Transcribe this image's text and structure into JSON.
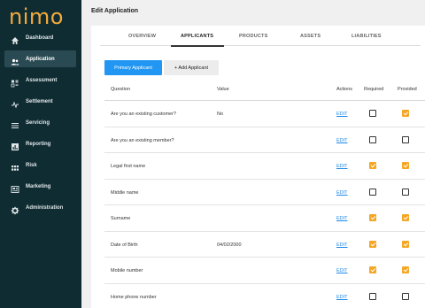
{
  "brand": {
    "logo_text": "nimo"
  },
  "sidebar": {
    "items": [
      {
        "label": "Dashboard",
        "icon": "home-icon"
      },
      {
        "label": "Application",
        "icon": "people-icon",
        "active": true
      },
      {
        "label": "Assessment",
        "icon": "assessment-icon"
      },
      {
        "label": "Settlement",
        "icon": "settlement-icon"
      },
      {
        "label": "Servicing",
        "icon": "list-icon"
      },
      {
        "label": "Reporting",
        "icon": "chart-icon"
      },
      {
        "label": "Risk",
        "icon": "grid-icon"
      },
      {
        "label": "Marketing",
        "icon": "marketing-icon"
      },
      {
        "label": "Administration",
        "icon": "gear-icon"
      }
    ]
  },
  "page": {
    "title": "Edit Application"
  },
  "tabs": [
    {
      "label": "OVERVIEW"
    },
    {
      "label": "APPLICANTS",
      "active": true
    },
    {
      "label": "PRODUCTS"
    },
    {
      "label": "ASSETS"
    },
    {
      "label": "LIABILITIES"
    }
  ],
  "applicant_buttons": {
    "primary": "Primary Applicant",
    "add": "+ Add Applicant"
  },
  "table": {
    "headers": {
      "question": "Question",
      "value": "Value",
      "actions": "Actions",
      "required": "Required",
      "provided": "Provided"
    },
    "edit_label": "EDIT",
    "rows": [
      {
        "question": "Are you an existing customer?",
        "value": "No",
        "required": false,
        "provided": true
      },
      {
        "question": "Are you an existing member?",
        "value": "",
        "required": false,
        "provided": false
      },
      {
        "question": "Legal first name",
        "value": "",
        "required": true,
        "provided": true
      },
      {
        "question": "Middle name",
        "value": "",
        "required": false,
        "provided": false
      },
      {
        "question": "Surname",
        "value": "",
        "required": true,
        "provided": true
      },
      {
        "question": "Date of Birth",
        "value": "04/02/2000",
        "required": true,
        "provided": true
      },
      {
        "question": "Mobile number",
        "value": "",
        "required": true,
        "provided": true
      },
      {
        "question": "Home phone number",
        "value": "",
        "required": false,
        "provided": false
      }
    ]
  },
  "colors": {
    "sidebar_bg": "#0f2c33",
    "brand": "#f4a93a",
    "primary": "#2196f3",
    "check": "#f5a623"
  }
}
